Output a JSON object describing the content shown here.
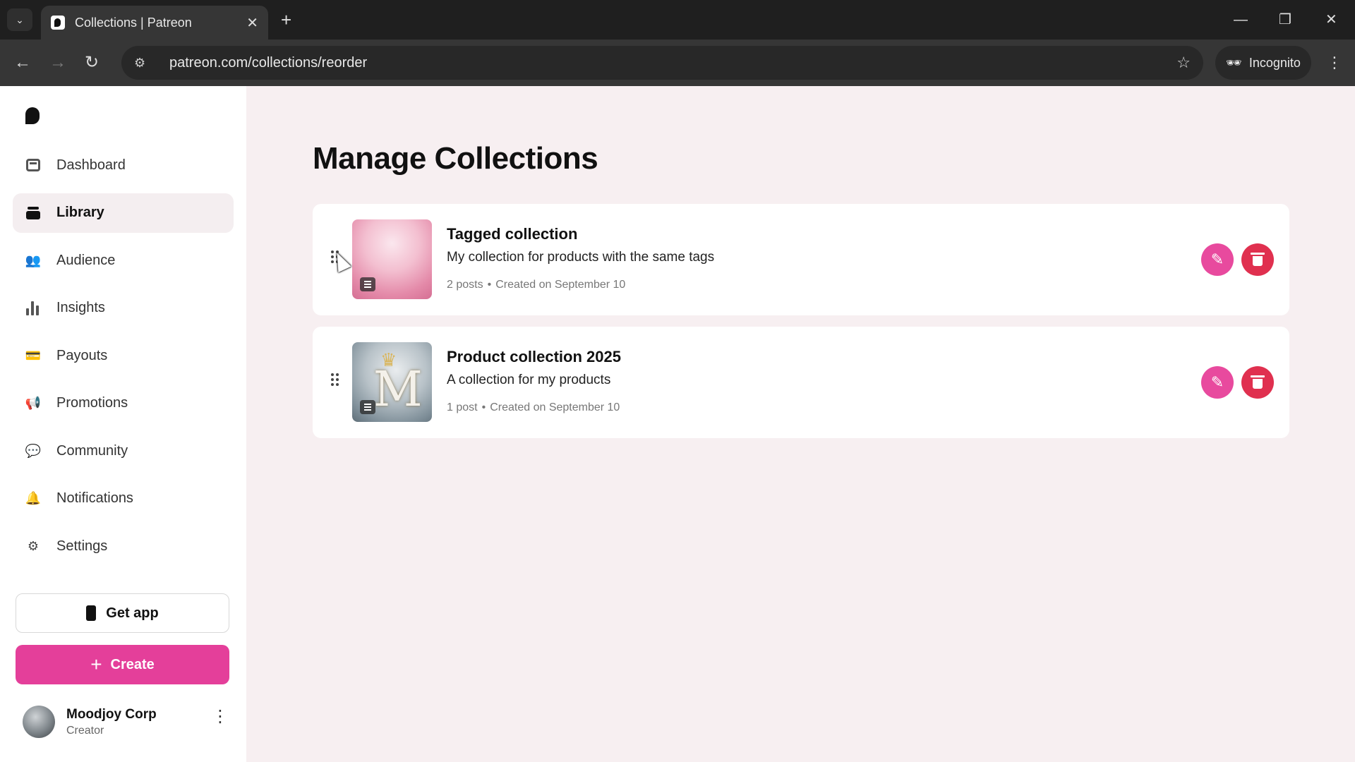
{
  "browser": {
    "tab_title": "Collections | Patreon",
    "url": "patreon.com/collections/reorder",
    "incognito_label": "Incognito"
  },
  "sidebar": {
    "items": [
      {
        "label": "Dashboard",
        "icon": "dashboard-icon",
        "active": false
      },
      {
        "label": "Library",
        "icon": "library-icon",
        "active": true
      },
      {
        "label": "Audience",
        "icon": "audience-icon",
        "active": false
      },
      {
        "label": "Insights",
        "icon": "insights-icon",
        "active": false
      },
      {
        "label": "Payouts",
        "icon": "payouts-icon",
        "active": false
      },
      {
        "label": "Promotions",
        "icon": "promotions-icon",
        "active": false
      },
      {
        "label": "Community",
        "icon": "community-icon",
        "active": false
      },
      {
        "label": "Notifications",
        "icon": "notifications-icon",
        "active": false
      },
      {
        "label": "Settings",
        "icon": "settings-icon",
        "active": false
      }
    ],
    "get_app_label": "Get app",
    "create_label": "Create",
    "profile": {
      "name": "Moodjoy Corp",
      "role": "Creator"
    }
  },
  "main": {
    "title": "Manage Collections",
    "collections": [
      {
        "title": "Tagged collection",
        "description": "My collection for products with the same tags",
        "posts": "2 posts",
        "created": "Created on September 10"
      },
      {
        "title": "Product collection 2025",
        "description": "A collection for my products",
        "posts": "1 post",
        "created": "Created on September 10"
      }
    ]
  },
  "colors": {
    "accent": "#e43f9a",
    "delete": "#e0304f",
    "background": "#f7eff1"
  }
}
